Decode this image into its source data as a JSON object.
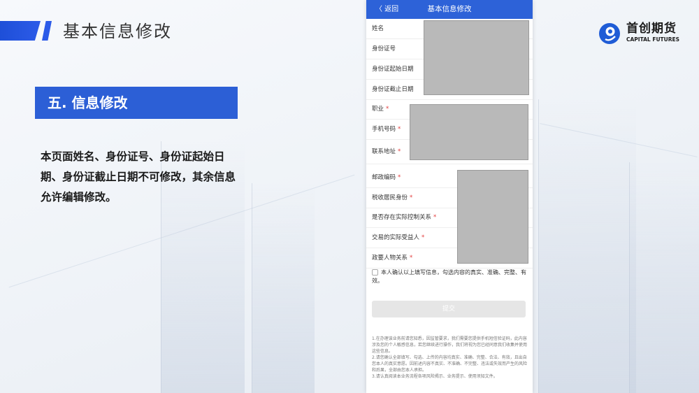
{
  "slide": {
    "title": "基本信息修改",
    "section_title": "五. 信息修改",
    "description": "本页面姓名、身份证号、身份证起始日期、身份证截止日期不可修改，其余信息允许编辑修改。"
  },
  "logo": {
    "cn": "首创期货",
    "en": "CAPITAL FUTURES"
  },
  "phone": {
    "nav": {
      "back_label": "〈 返回",
      "title": "基本信息修改"
    },
    "fields": [
      {
        "label": "姓名",
        "required": false
      },
      {
        "label": "身份证号",
        "required": false
      },
      {
        "label": "身份证起始日期",
        "required": false
      },
      {
        "label": "身份证截止日期",
        "required": false
      },
      {
        "label": "职业",
        "required": true
      },
      {
        "label": "手机号码",
        "required": true
      },
      {
        "label": "联系地址",
        "required": true
      },
      {
        "label": "邮政编码",
        "required": true
      },
      {
        "label": "税收居民身份",
        "required": true
      },
      {
        "label": "是否存在实际控制关系",
        "required": true
      },
      {
        "label": "交易的实际受益人",
        "required": true
      },
      {
        "label": "政要人物关系",
        "required": true
      }
    ],
    "required_mark": "*",
    "confirm_text": "本人确认以上填写信息，勾选内容的真实、准确、完整、有效。",
    "submit_label": "提交",
    "notes": [
      "1.在办理该业务前请您知悉，因监管要求，我们需要您提供手机短信验证码，此内容涉及您的个人敏感信息，若您继续进行操作，我们将视为您已经同意我们收集并使用这些信息。",
      "2.请您确认全部填写、勾选、上传的内容均真实、准确、完整、合法、有效，且出自您本人的真实意愿。因前述内容不真实、不准确、不完整、违法或失效而产生的风险和后果，全部由您本人承担。",
      "3.请认真阅读本业务流程各项风险揭示、业务提示、使用须知文件。"
    ]
  },
  "colors": {
    "accent": "#2c5fd6",
    "nav": "#2d62d8",
    "required": "#e23b3b",
    "mask": "#b9b9b9"
  }
}
